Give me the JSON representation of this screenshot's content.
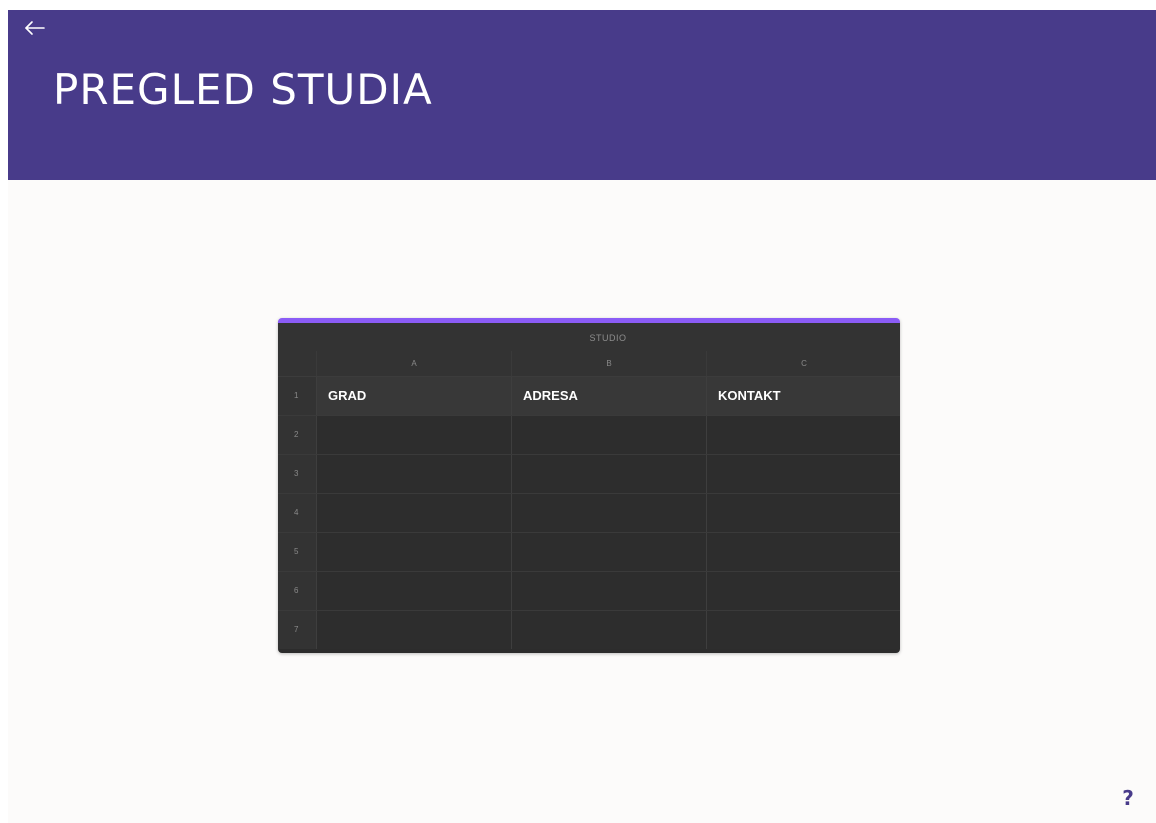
{
  "header": {
    "title": "PREGLED STUDIA",
    "back_icon": "arrow-left-icon",
    "background_color": "#483b8a"
  },
  "sheet": {
    "title": "STUDIO",
    "accent_color": "#8b5cf6",
    "column_letters": [
      "A",
      "B",
      "C"
    ],
    "rows": [
      {
        "number": "1",
        "cells": [
          "GRAD",
          "ADRESA",
          "KONTAKT"
        ]
      },
      {
        "number": "2",
        "cells": [
          "",
          "",
          ""
        ]
      },
      {
        "number": "3",
        "cells": [
          "",
          "",
          ""
        ]
      },
      {
        "number": "4",
        "cells": [
          "",
          "",
          ""
        ]
      },
      {
        "number": "5",
        "cells": [
          "",
          "",
          ""
        ]
      },
      {
        "number": "6",
        "cells": [
          "",
          "",
          ""
        ]
      },
      {
        "number": "7",
        "cells": [
          "",
          "",
          ""
        ]
      }
    ]
  },
  "help": {
    "label": "?"
  }
}
